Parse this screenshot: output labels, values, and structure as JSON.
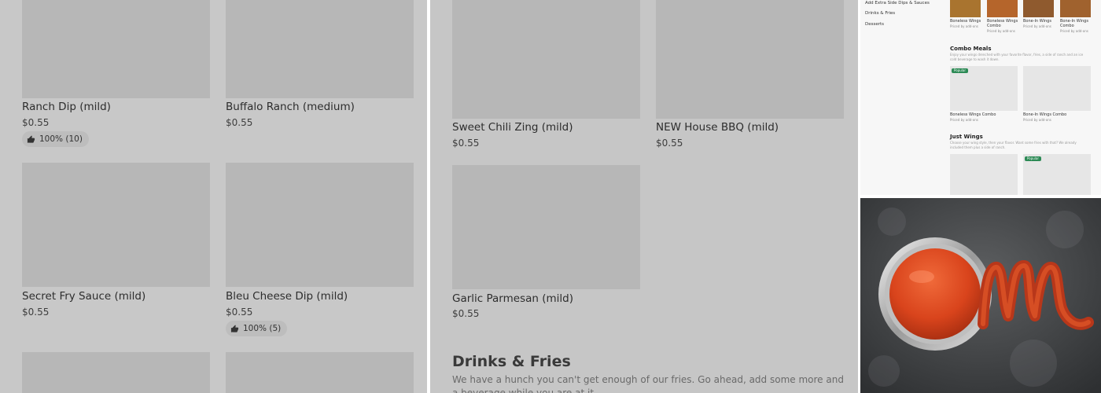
{
  "left_panel": {
    "items": [
      {
        "name": "Ranch Dip (mild)",
        "price": "$0.55",
        "rating": "100% (10)"
      },
      {
        "name": "Buffalo Ranch (medium)",
        "price": "$0.55"
      },
      {
        "name": "Secret Fry Sauce (mild)",
        "price": "$0.55"
      },
      {
        "name": "Bleu Cheese Dip (mild)",
        "price": "$0.55",
        "rating": "100% (5)"
      }
    ]
  },
  "middle_panel": {
    "items": [
      {
        "name": "Sweet Chili Zing (mild)",
        "price": "$0.55"
      },
      {
        "name": "NEW House BBQ (mild)",
        "price": "$0.55"
      },
      {
        "name": "Garlic Parmesan (mild)",
        "price": "$0.55"
      }
    ],
    "section": {
      "title": "Drinks & Fries",
      "description": "We have a hunch you can't get enough of our fries. Go ahead, add some more and a beverage while you are at it."
    }
  },
  "mini_screenshot": {
    "sidebar": [
      "Add Extra Side Dips & Sauces",
      "Drinks & Fries",
      "Desserts"
    ],
    "top_items": [
      {
        "name": "Boneless Wings",
        "sub": "Priced by add-ons"
      },
      {
        "name": "Boneless Wings Combo",
        "sub": "Priced by add-ons"
      },
      {
        "name": "Bone-In Wings",
        "sub": "Priced by add-ons"
      },
      {
        "name": "Bone-In Wings Combo",
        "sub": "Priced by add-ons"
      }
    ],
    "combo": {
      "title": "Combo Meals",
      "desc": "Enjoy your wings drenched with your favorite flavor, fries, a side of ranch and an ice cold beverage to wash it down.",
      "badge": "Popular",
      "items": [
        {
          "name": "Boneless Wings Combo",
          "sub": "Priced by add-ons"
        },
        {
          "name": "Bone-In Wings Combo",
          "sub": "Priced by add-ons"
        }
      ]
    },
    "just_wings": {
      "title": "Just Wings",
      "desc": "Choose your wing style, then your flavor. Want some fries with that? We already included them plus a side of ranch.",
      "badge": "Popular"
    }
  },
  "colors": {
    "overlay_gray": "#c8c8c8",
    "thumb_gray": "#b7b7b7",
    "popular_green": "#2c8a55",
    "sauce_red": "#d9441c"
  },
  "icons": {
    "rating": "thumbs-up-icon"
  }
}
